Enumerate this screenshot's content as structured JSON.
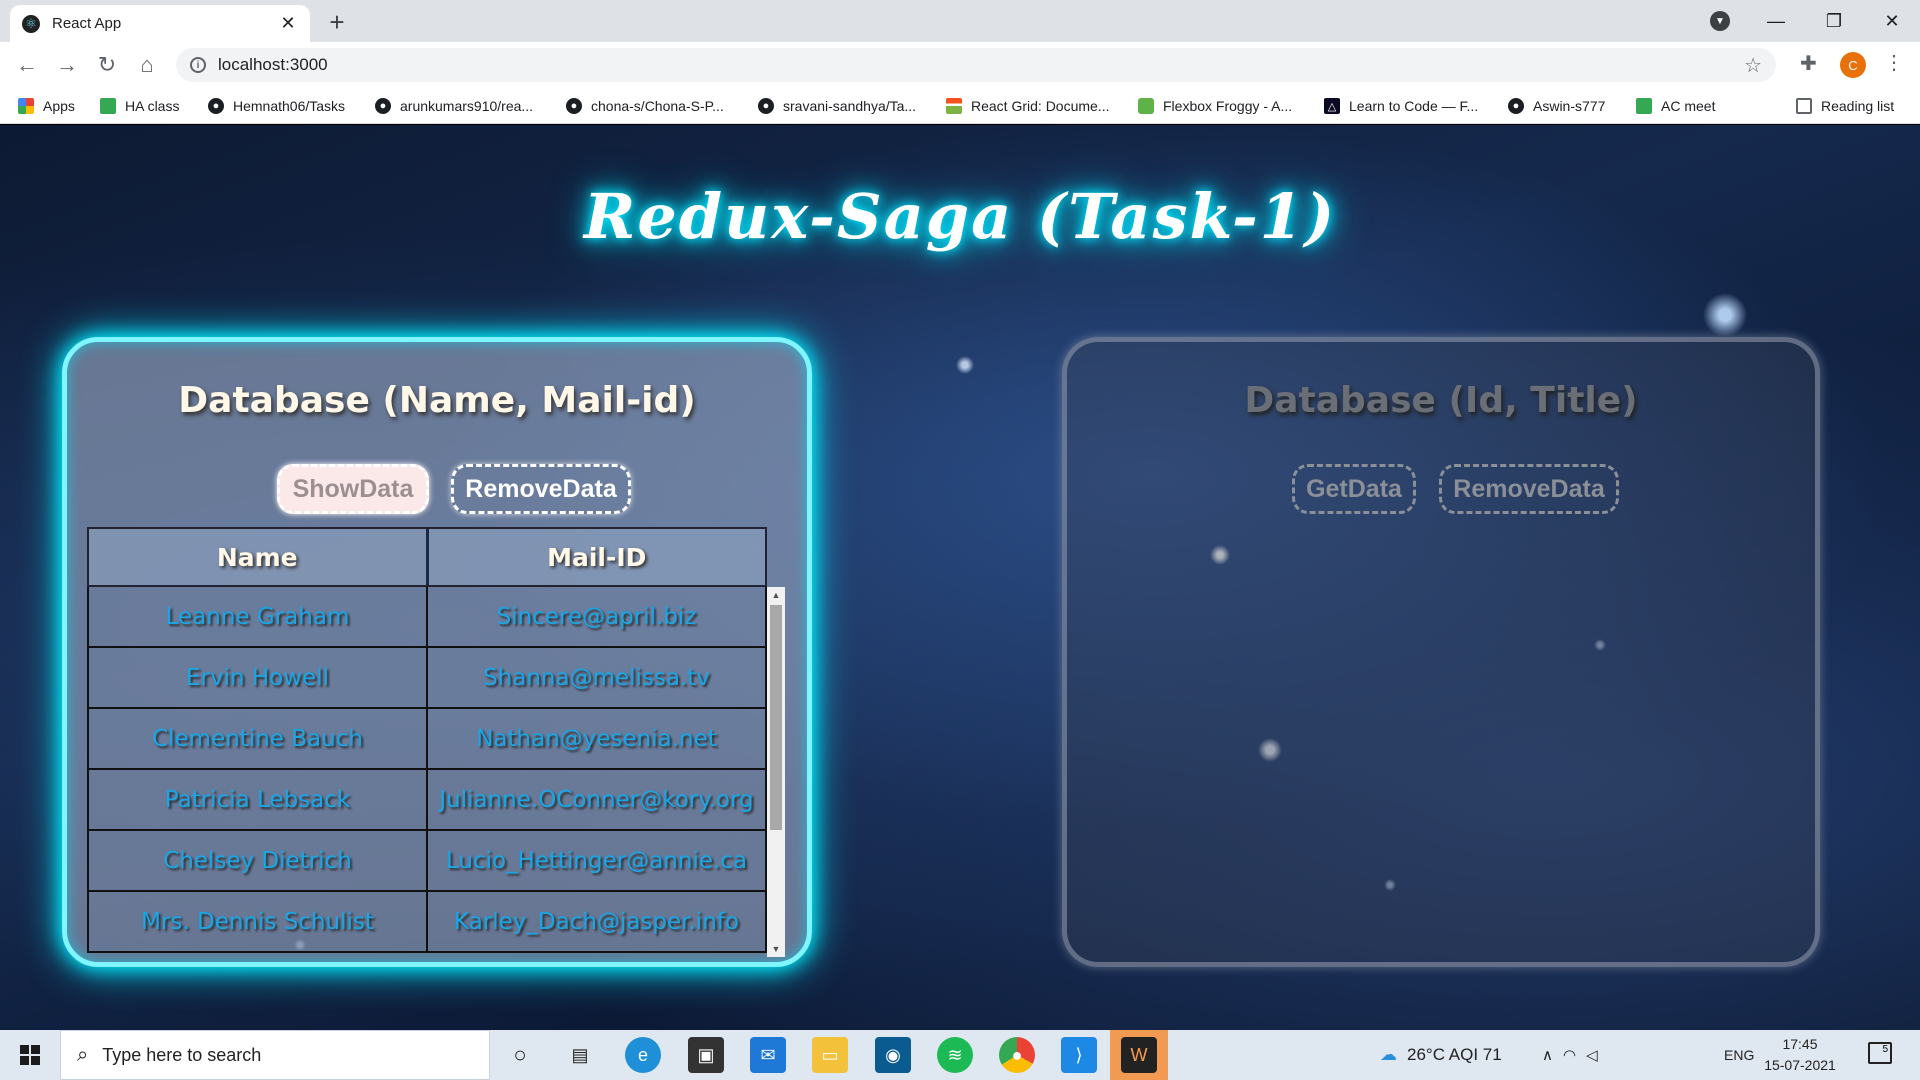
{
  "browser": {
    "tab_title": "React App",
    "url": "localhost:3000",
    "profile_initial": "C",
    "bookmarks": [
      {
        "label": "Apps",
        "icon": "apps-grid-icon"
      },
      {
        "label": "HA class",
        "icon": "classroom-icon"
      },
      {
        "label": "Hemnath06/Tasks",
        "icon": "github-icon"
      },
      {
        "label": "arunkumars910/rea...",
        "icon": "github-icon"
      },
      {
        "label": "chona-s/Chona-S-P...",
        "icon": "github-icon"
      },
      {
        "label": "sravani-sandhya/Ta...",
        "icon": "github-icon"
      },
      {
        "label": "React Grid: Docume...",
        "icon": "react-grid-icon"
      },
      {
        "label": "Flexbox Froggy - A...",
        "icon": "froggy-icon"
      },
      {
        "label": "Learn to Code — F...",
        "icon": "freecodecamp-icon"
      },
      {
        "label": "Aswin-s777",
        "icon": "github-icon"
      },
      {
        "label": "AC meet",
        "icon": "meet-icon"
      }
    ],
    "reading_list": "Reading list"
  },
  "app": {
    "title": "Redux-Saga (Task-1)",
    "left_panel": {
      "title": "Database (Name, Mail-id)",
      "show_button": "ShowData",
      "remove_button": "RemoveData",
      "columns": [
        "Name",
        "Mail-ID"
      ],
      "rows": [
        {
          "name": "Leanne Graham",
          "mail": "Sincere@april.biz"
        },
        {
          "name": "Ervin Howell",
          "mail": "Shanna@melissa.tv"
        },
        {
          "name": "Clementine Bauch",
          "mail": "Nathan@yesenia.net"
        },
        {
          "name": "Patricia Lebsack",
          "mail": "Julianne.OConner@kory.org"
        },
        {
          "name": "Chelsey Dietrich",
          "mail": "Lucio_Hettinger@annie.ca"
        },
        {
          "name": "Mrs. Dennis Schulist",
          "mail": "Karley_Dach@jasper.info"
        }
      ]
    },
    "right_panel": {
      "title": "Database (Id, Title)",
      "get_button": "GetData",
      "remove_button": "RemoveData"
    }
  },
  "taskbar": {
    "search_placeholder": "Type here to search",
    "weather": "26°C  AQI 71",
    "language": "ENG",
    "time": "17:45",
    "date": "15-07-2021",
    "notification_count": "5"
  },
  "colors": {
    "neon_accent": "#00e5ff",
    "email_text": "#1aa6e6",
    "show_button_bg": "#fbe9ea"
  }
}
